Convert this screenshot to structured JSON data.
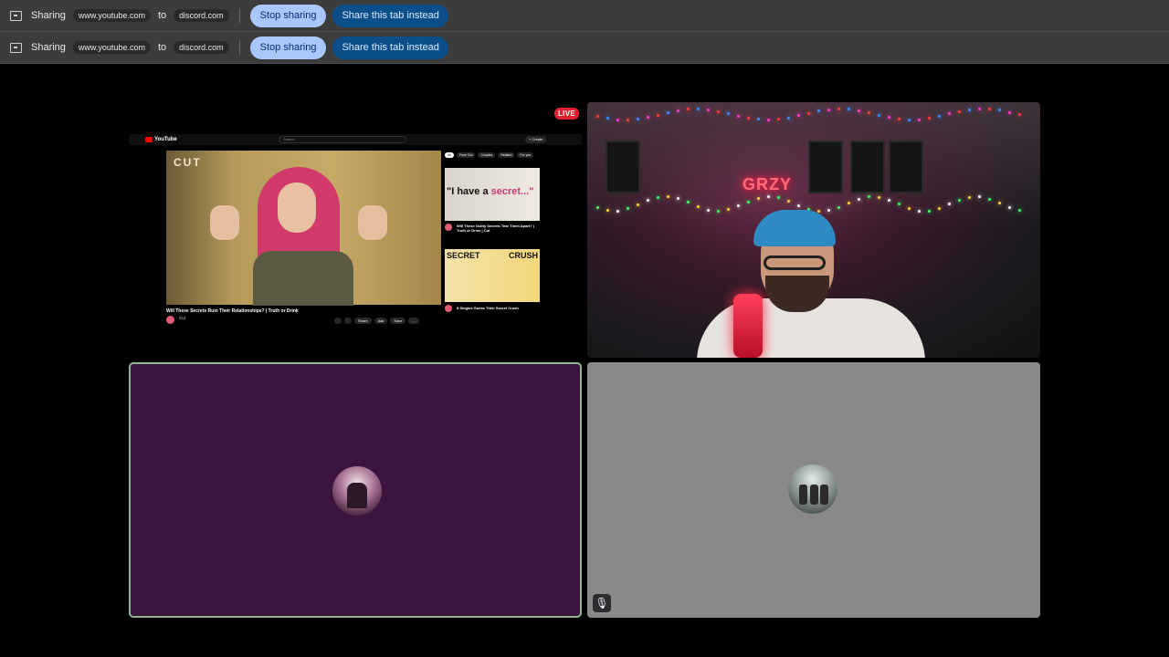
{
  "share_bars": [
    {
      "label": "Sharing",
      "source": "www.youtube.com",
      "to": "to",
      "target": "discord.com",
      "stop_label": "Stop sharing",
      "switch_label": "Share this tab instead"
    },
    {
      "label": "Sharing",
      "source": "www.youtube.com",
      "to": "to",
      "target": "discord.com",
      "stop_label": "Stop sharing",
      "switch_label": "Share this tab instead"
    }
  ],
  "stream": {
    "live_badge": "LIVE",
    "youtube": {
      "logo_text": "YouTube",
      "search_placeholder": "Search",
      "create_label": "+ Create",
      "channel_logo": "CUT",
      "video_title": "Will These Secrets Ruin Their Relationships? | Truth or Drink",
      "channel_name": "Cut",
      "action_buttons": [
        "",
        "",
        "Share",
        "Ask",
        "Save",
        "..."
      ],
      "chips": [
        "All",
        "From Cut",
        "Couples",
        "Related",
        "For you"
      ],
      "side_videos": [
        {
          "thumb_text_a": "\"I have a",
          "thumb_text_b": "secret...\"",
          "title": "Will These Guilty Secrets Tear Them Apart? | Truth or Drink | Cut"
        },
        {
          "thumb_text_a": "SECRET",
          "thumb_text_b": "CRUSH",
          "title": "8 Singles Guess Their Secret Crush"
        }
      ]
    },
    "neon_sign": "GRZY"
  },
  "participants": [
    {
      "tile_color": "#3b1540",
      "speaking": true
    },
    {
      "tile_color": "#898a88",
      "muted": true
    }
  ],
  "colors": {
    "bar_bg": "#3c3c3c",
    "stop_btn": "#a8c7fa",
    "share_btn": "#0b4f8a",
    "live": "#e0202f",
    "speaking_border": "#8fb78e"
  }
}
